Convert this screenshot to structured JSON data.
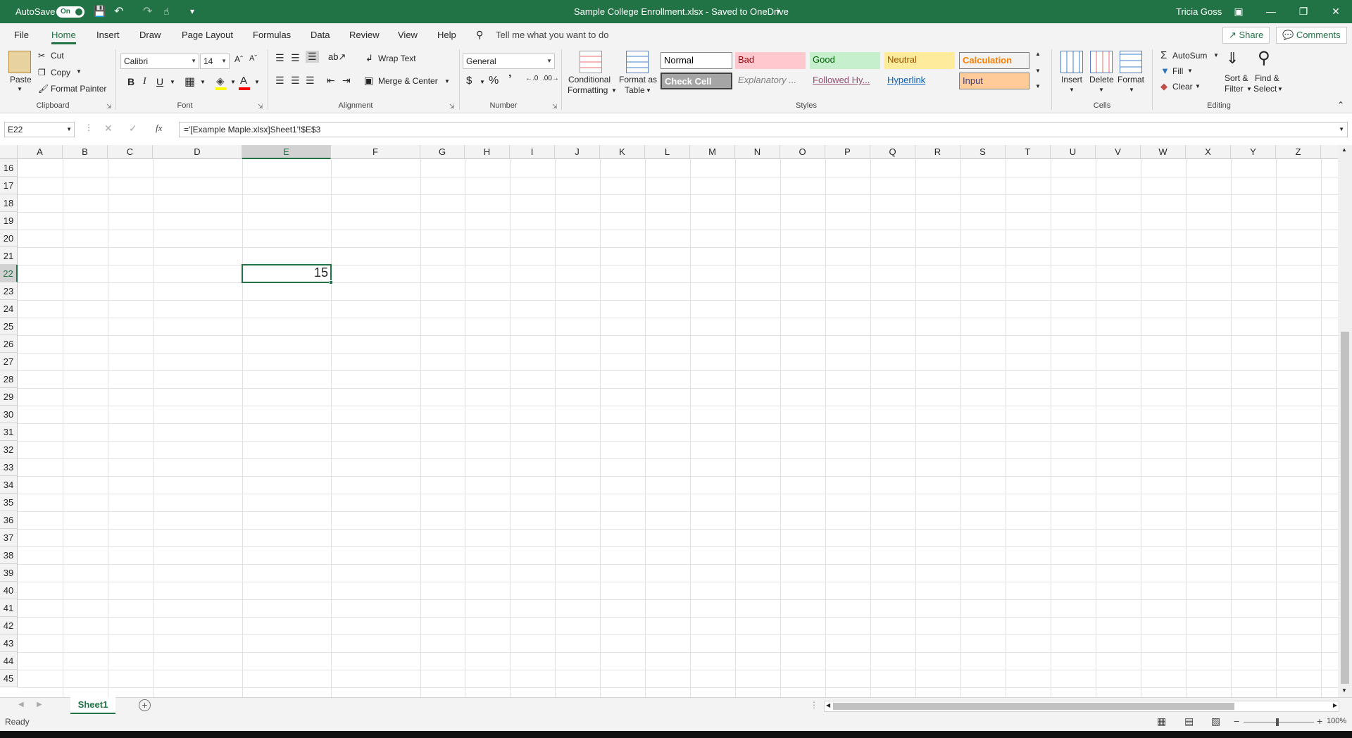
{
  "titlebar": {
    "autosave_label": "AutoSave",
    "autosave_state": "On",
    "document_title": "Sample College Enrollment.xlsx  -  Saved to OneDrive",
    "user_name": "Tricia Goss"
  },
  "tabs": [
    "File",
    "Home",
    "Insert",
    "Draw",
    "Page Layout",
    "Formulas",
    "Data",
    "Review",
    "View",
    "Help"
  ],
  "active_tab": "Home",
  "search_placeholder": "Tell me what you want to do",
  "share_label": "Share",
  "comments_label": "Comments",
  "ribbon": {
    "clipboard": {
      "paste": "Paste",
      "cut": "Cut",
      "copy": "Copy",
      "format_painter": "Format Painter",
      "label": "Clipboard"
    },
    "font": {
      "family": "Calibri",
      "size": "14",
      "bold": "B",
      "italic": "I",
      "underline": "U",
      "label": "Font"
    },
    "alignment": {
      "wrap_text": "Wrap Text",
      "merge_center": "Merge & Center",
      "label": "Alignment"
    },
    "number": {
      "format": "General",
      "label": "Number"
    },
    "styles": {
      "conditional_line1": "Conditional",
      "conditional_line2": "Formatting",
      "format_table_line1": "Format as",
      "format_table_line2": "Table",
      "normal": "Normal",
      "bad": "Bad",
      "good": "Good",
      "neutral": "Neutral",
      "calculation": "Calculation",
      "check_cell": "Check Cell",
      "explanatory": "Explanatory ...",
      "followed": "Followed Hy...",
      "hyperlink": "Hyperlink",
      "input": "Input",
      "label": "Styles"
    },
    "cells": {
      "insert": "Insert",
      "delete": "Delete",
      "format": "Format",
      "label": "Cells"
    },
    "editing": {
      "autosum": "AutoSum",
      "fill": "Fill",
      "clear": "Clear",
      "sort_line1": "Sort &",
      "sort_line2": "Filter",
      "find_line1": "Find &",
      "find_line2": "Select",
      "label": "Editing"
    }
  },
  "formula_bar": {
    "name_box": "E22",
    "fx": "fx",
    "formula": "='[Example Maple.xlsx]Sheet1'!$E$3"
  },
  "grid": {
    "columns": [
      "A",
      "B",
      "C",
      "D",
      "E",
      "F",
      "G",
      "H",
      "I",
      "J",
      "K",
      "L",
      "M",
      "N",
      "O",
      "P",
      "Q",
      "R",
      "S",
      "T",
      "U",
      "V",
      "W",
      "X",
      "Y",
      "Z"
    ],
    "rows": [
      "16",
      "17",
      "18",
      "19",
      "20",
      "21",
      "22",
      "23",
      "24",
      "25",
      "26",
      "27",
      "28",
      "29",
      "30",
      "31",
      "32",
      "33",
      "34",
      "35",
      "36",
      "37",
      "38",
      "39",
      "40",
      "41",
      "42",
      "43",
      "44",
      "45"
    ],
    "selected_column": "E",
    "selected_row": "22",
    "active_cell_value": "15"
  },
  "sheet_tabs": [
    "Sheet1"
  ],
  "status": {
    "ready": "Ready",
    "zoom": "100%"
  },
  "colors": {
    "excel_green": "#217346",
    "bad_fill": "#ffc7ce",
    "good_fill": "#c6efce",
    "neutral_fill": "#ffeb9c",
    "input_fill": "#ffcc99"
  }
}
